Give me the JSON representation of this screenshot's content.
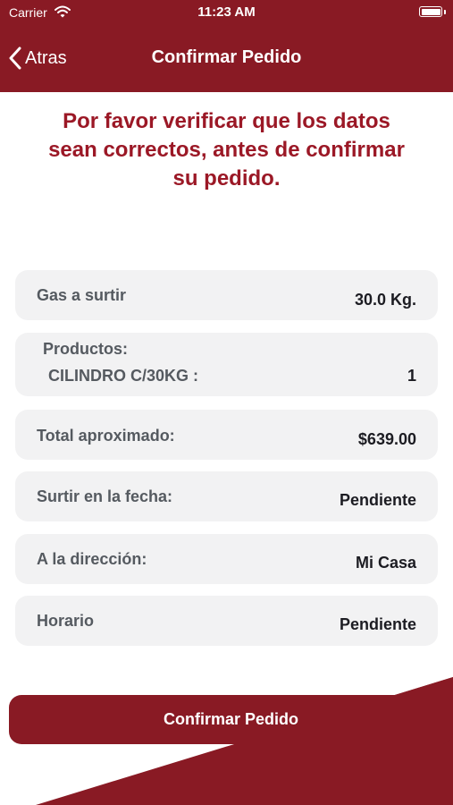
{
  "status_bar": {
    "carrier": "Carrier",
    "time": "11:23 AM"
  },
  "nav": {
    "back_label": "Atras",
    "title": "Confirmar Pedido"
  },
  "notice": {
    "line1": "Por favor verificar que los datos",
    "line2": "sean correctos, antes de confirmar",
    "line3": "su pedido."
  },
  "rows": {
    "gas": {
      "label": "Gas a surtir",
      "value": "30.0 Kg."
    },
    "products": {
      "label": "Productos:",
      "item_name": "CILINDRO C/30KG :",
      "item_qty": "1"
    },
    "total": {
      "label": "Total aproximado:",
      "value": "$639.00"
    },
    "date": {
      "label": "Surtir en la fecha:",
      "value": "Pendiente"
    },
    "address": {
      "label": "A la dirección:",
      "value": "Mi Casa"
    },
    "schedule": {
      "label": "Horario",
      "value": "Pendiente"
    }
  },
  "confirm_button": {
    "label": "Confirmar Pedido"
  },
  "colors": {
    "brand": "#891a24",
    "notice_text": "#9b1826",
    "card_bg": "#f2f2f3"
  }
}
